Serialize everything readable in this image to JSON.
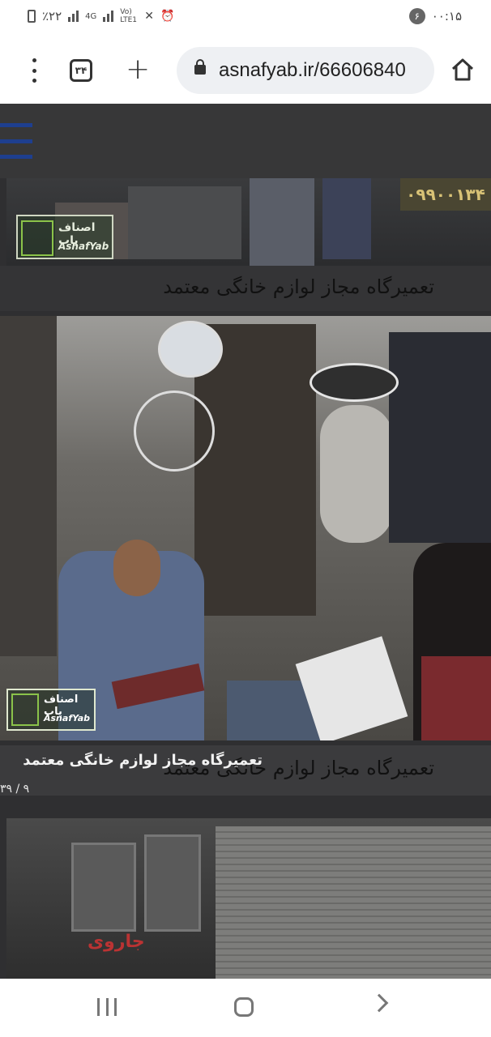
{
  "status_bar": {
    "battery": "٪۲۲",
    "network": "4G",
    "volte": "Vo) LTE1",
    "notification_count": "۶",
    "time": "۰۰:۱۵"
  },
  "browser": {
    "tab_count": "۳۴",
    "url": "asnafyab.ir/66606840"
  },
  "page": {
    "card1": {
      "phone_banner": "۰۹۹۰۰۱۳۴",
      "logo_fa": "اصناف یاب",
      "logo_en": "AsnafYab",
      "title": "تعمیرگاه مجاز لوازم خانگی معتمد"
    },
    "card2": {
      "logo_fa": "اصناف یاب",
      "logo_en": "AsnafYab",
      "title": "تعمیرگاه مجاز لوازم خانگی معتمد",
      "title_overlay": "تعمیرگاه مجاز لوازم خانگی معتمد",
      "counter": "۳۹ / ۹"
    },
    "card3": {
      "sign_text": "جاروی"
    }
  },
  "colors": {
    "page_bg": "#2f2f31",
    "menu_accent": "#1e3f8f",
    "logo_green": "#8bc34a"
  }
}
